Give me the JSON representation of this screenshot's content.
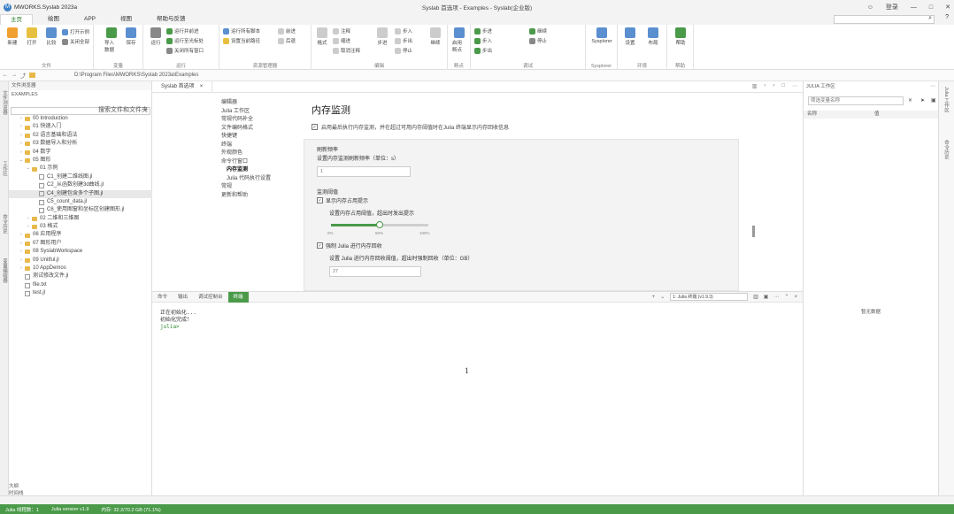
{
  "titlebar": {
    "app_name": "MWORKS.Syslab 2023a",
    "title": "Syslab 首选项 - Examples - Syslab(企业版)",
    "user": "登录",
    "logo_glyph": "M"
  },
  "menu": {
    "tabs": [
      "主页",
      "绘图",
      "APP",
      "视图",
      "帮助与反馈"
    ],
    "active": "主页"
  },
  "ribbon": {
    "groups": [
      "文件",
      "变量",
      "运行",
      "资源管理器",
      "编辑",
      "断点",
      "调试",
      "Sysplorer",
      "环境",
      "帮助"
    ],
    "file_buttons": [
      "新建",
      "打开",
      "比较",
      "打开示例",
      "关闭全部"
    ],
    "var_buttons": [
      "导入数据",
      "保存"
    ],
    "run_buttons": [
      "运行",
      "运行并前进",
      "运行至光标处",
      "关闭所有窗口"
    ],
    "explorer_buttons": [
      "运行所有脚本",
      "设置当前路径",
      "前进",
      "后退"
    ],
    "edit_buttons": [
      "格式",
      "注释",
      "缩进",
      "取消注释",
      "启用断点"
    ],
    "debug_buttons": [
      "步进",
      "步入",
      "步出",
      "继续",
      "停止"
    ],
    "sysplorer_label": "Sysplorer",
    "env_buttons": [
      "设置",
      "布局"
    ],
    "help_buttons": [
      "帮助"
    ]
  },
  "address": {
    "path": "D:\\Program Files\\MWORKS\\Syslab 2023a\\Examples"
  },
  "left_rail": [
    "文件浏览器",
    "工作区",
    "命令历史",
    "变量编辑器"
  ],
  "file_panel": {
    "header": "文件浏览器",
    "root": "EXAMPLES",
    "search_placeholder": "搜索文件和文件夹",
    "items": [
      {
        "name": "00 Introduction",
        "type": "folder",
        "level": 0
      },
      {
        "name": "01 快速入门",
        "type": "folder",
        "level": 0
      },
      {
        "name": "02 语言基础和语法",
        "type": "folder",
        "level": 0
      },
      {
        "name": "03 数据导入和分析",
        "type": "folder",
        "level": 0
      },
      {
        "name": "04 数学",
        "type": "folder",
        "level": 0
      },
      {
        "name": "05 图形",
        "type": "folder",
        "level": 0,
        "open": true
      },
      {
        "name": "01 示例",
        "type": "folder",
        "level": 1,
        "open": true
      },
      {
        "name": "C1_创建二维线图.jl",
        "type": "file",
        "level": 2
      },
      {
        "name": "C2_从函数创建3d曲线.jl",
        "type": "file",
        "level": 2
      },
      {
        "name": "C4_创建包含多个子图.jl",
        "type": "file",
        "level": 2
      },
      {
        "name": "C5_count_data.jl",
        "type": "file",
        "level": 2
      },
      {
        "name": "C6_使用图窗和坐标区创建图形.jl",
        "type": "file",
        "level": 2
      },
      {
        "name": "02 二维和三维图",
        "type": "folder",
        "level": 1
      },
      {
        "name": "03 格式",
        "type": "folder",
        "level": 1
      },
      {
        "name": "06 应用程序",
        "type": "folder",
        "level": 0
      },
      {
        "name": "07 图形用户",
        "type": "folder",
        "level": 0
      },
      {
        "name": "08 SyslabWorkspace",
        "type": "folder",
        "level": 0
      },
      {
        "name": "09 Unitful.jl",
        "type": "folder",
        "level": 0
      },
      {
        "name": "10 AppDemos",
        "type": "folder",
        "level": 0
      },
      {
        "name": "测试修改文件.jl",
        "type": "file",
        "level": 0
      },
      {
        "name": "file.txt",
        "type": "file",
        "level": 0
      },
      {
        "name": "test.jl",
        "type": "file",
        "level": 0
      }
    ],
    "bottom": [
      "大纲",
      "时间线"
    ]
  },
  "editor": {
    "tab_label": "Syslab 首选项",
    "nav": [
      "编辑器",
      "Julia 工作区",
      "常规代码补全",
      "文件编码格式",
      "快捷键",
      "终端",
      "外观颜色",
      "命令行窗口",
      "内存监测",
      "Julia 代码执行设置",
      "常规",
      "更新和帮助"
    ],
    "title": "内存监测",
    "desc": "启用最后执行内存监测，并在超过可用内存阈值时在Julia 终端显示内存回收信息",
    "section1": "刷新频率",
    "refresh_label": "设置内存监测刷新频率（单位：s）",
    "refresh_value": "1",
    "section2": "监测阈值",
    "warn_check": "显示内存占用提示",
    "warn_label": "设置内存占用阈值，超出时发出提示",
    "tick_min": "0%",
    "tick_mid": "50%",
    "tick_max": "100%",
    "slider_value": 0.5,
    "gc_check": "强制 Julia 进行内存回收",
    "gc_label": "设置 Julia 进行内存回收阈值，超出时强制回收（单位：GB）",
    "gc_value": "27"
  },
  "console": {
    "tabs": [
      "命令",
      "输出",
      "调试控制台",
      "终端"
    ],
    "active": "终端",
    "env": "1: Julia 终端 (v1.9.3)",
    "lines": [
      "正在初始化...",
      "初始化完成！"
    ],
    "prompt": "julia>",
    "center_text": "1"
  },
  "julia_panel": {
    "title": "JULIA 工作区",
    "search_placeholder": "筛选变量名称",
    "col_name": "名称",
    "col_value": "值",
    "empty": "暂无数据"
  },
  "right_rail": [
    "Julia 工作区",
    "命令历史"
  ],
  "status": {
    "items": [
      "Julia 线程数：1",
      "Julia version v1.9",
      "内存: 32.2/70.2 GB (71.1%)"
    ]
  },
  "colors": {
    "accent": "#4a9a4a",
    "folder": "#e8b94a"
  }
}
